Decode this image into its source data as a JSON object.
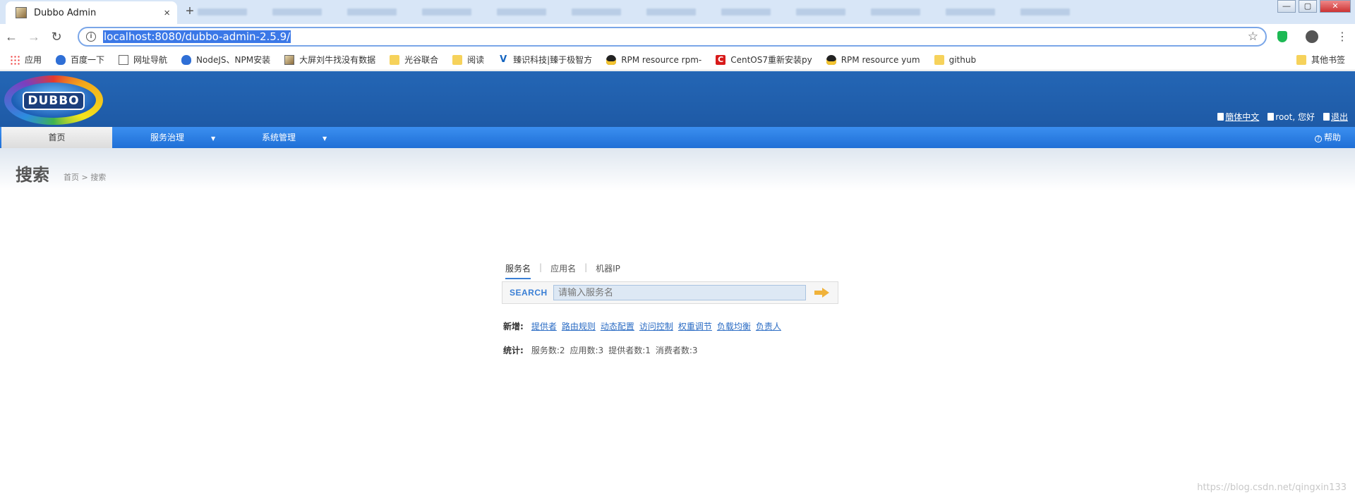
{
  "browser": {
    "tab_title": "Dubbo Admin",
    "tab_close": "×",
    "new_tab": "+",
    "url": "localhost:8080/dubbo-admin-2.5.9/",
    "win_min": "—",
    "win_max": "▢",
    "win_close": "✕"
  },
  "bookmarks": {
    "items": [
      {
        "label": "应用",
        "icon": "apps-icon"
      },
      {
        "label": "百度一下",
        "icon": "paw-icon"
      },
      {
        "label": "网址导航",
        "icon": "page-icon"
      },
      {
        "label": "NodeJS、NPM安装",
        "icon": "paw-icon"
      },
      {
        "label": "大屏刘牛找没有数据",
        "icon": "image-icon"
      },
      {
        "label": "光谷联合",
        "icon": "folder-icon"
      },
      {
        "label": "阅读",
        "icon": "folder-icon"
      },
      {
        "label": "臻识科技|臻于极智方",
        "icon": "v-icon"
      },
      {
        "label": "RPM resource rpm-",
        "icon": "tux-icon"
      },
      {
        "label": "CentOS7重新安装py",
        "icon": "c-icon"
      },
      {
        "label": "RPM resource yum",
        "icon": "tux-icon"
      },
      {
        "label": "github",
        "icon": "folder-icon"
      }
    ],
    "other": "其他书签"
  },
  "header": {
    "logo_text": "DUBBO",
    "lang": "簡体中文",
    "user": "root, 您好",
    "logout": "退出"
  },
  "menu": {
    "home": "首页",
    "service": "服务治理",
    "system": "系统管理",
    "help": "帮助",
    "arrow": "▼"
  },
  "page": {
    "title": "搜索",
    "breadcrumb": "首页 > 搜索"
  },
  "search": {
    "tabs": [
      "服务名",
      "应用名",
      "机器IP"
    ],
    "label": "SEARCH",
    "placeholder": "请输入服务名"
  },
  "new_links": {
    "label": "新增:",
    "items": [
      "提供者",
      "路由规则",
      "动态配置",
      "访问控制",
      "权重调节",
      "负载均衡",
      "负责人"
    ]
  },
  "stats": {
    "label": "统计:",
    "items": [
      "服务数:2",
      "应用数:3",
      "提供者数:1",
      "消费者数:3"
    ]
  },
  "watermark": "https://blog.csdn.net/qingxin133"
}
